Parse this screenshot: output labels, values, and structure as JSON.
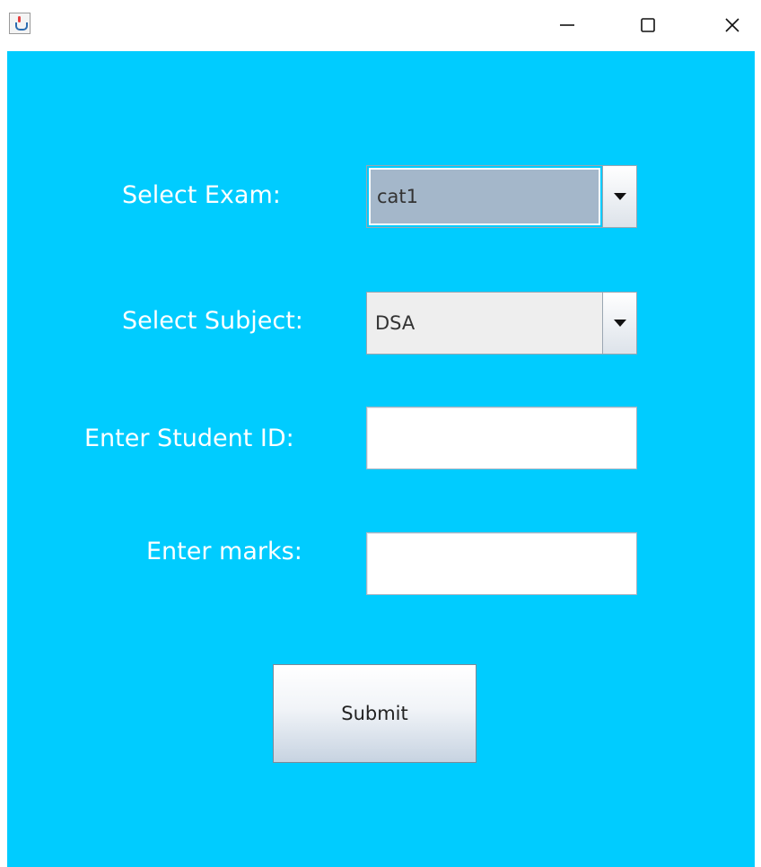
{
  "window": {
    "icon": "java-cup-icon",
    "controls": {
      "minimize": "minimize-icon",
      "maximize": "maximize-icon",
      "close": "close-icon"
    }
  },
  "form": {
    "background_color": "#00ccff",
    "exam": {
      "label": "Select Exam:",
      "selected": "cat1"
    },
    "subject": {
      "label": "Select Subject:",
      "selected": "DSA"
    },
    "student_id": {
      "label": "Enter Student ID:",
      "value": ""
    },
    "marks": {
      "label": "Enter marks:",
      "value": ""
    },
    "submit_label": "Submit"
  }
}
